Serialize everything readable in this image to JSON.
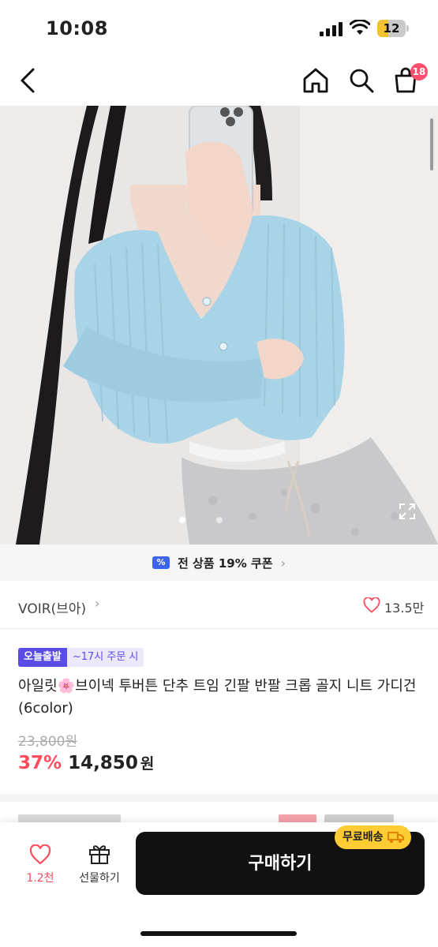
{
  "status_bar": {
    "time": "10:08",
    "battery": "12",
    "icons": [
      "signal-icon",
      "wifi-icon",
      "battery-icon"
    ]
  },
  "nav": {
    "icons": [
      "back-icon",
      "home-icon",
      "search-icon",
      "shopping-bag-icon"
    ],
    "cart_badge": "18"
  },
  "hero": {
    "image_count_dots": 2,
    "active_index": 0,
    "icons": [
      "expand-icon"
    ]
  },
  "coupon": {
    "icon_glyph": "%",
    "text": "전 상품 19% 쿠폰",
    "chevron": "›"
  },
  "brand": {
    "name": "VOIR(브아)",
    "chevron": "›",
    "likes": "13.5만"
  },
  "product": {
    "tag_primary": "오늘출발",
    "tag_secondary": "~17시 주문 시",
    "title": "아일릿🌸브이넥 투버튼 단추 트임 긴팔 반팔 크롭 골지 니트 가디건 (6color)",
    "original_price": "23,800원",
    "discount": "37%",
    "price": "14,850",
    "currency": "원"
  },
  "bottom_bar": {
    "like_count": "1.2천",
    "gift_label": "선물하기",
    "buy_label": "구매하기",
    "free_shipping": "무료배송"
  },
  "colors": {
    "accent_red": "#ff4d5e",
    "badge_pink": "#ff4d6d",
    "tag_purple": "#5b4ce6",
    "coupon_blue": "#3b63f0",
    "buy_black": "#111111",
    "free_ship_yellow": "#ffcc33",
    "cardigan_blue": "#a9d3e6"
  }
}
